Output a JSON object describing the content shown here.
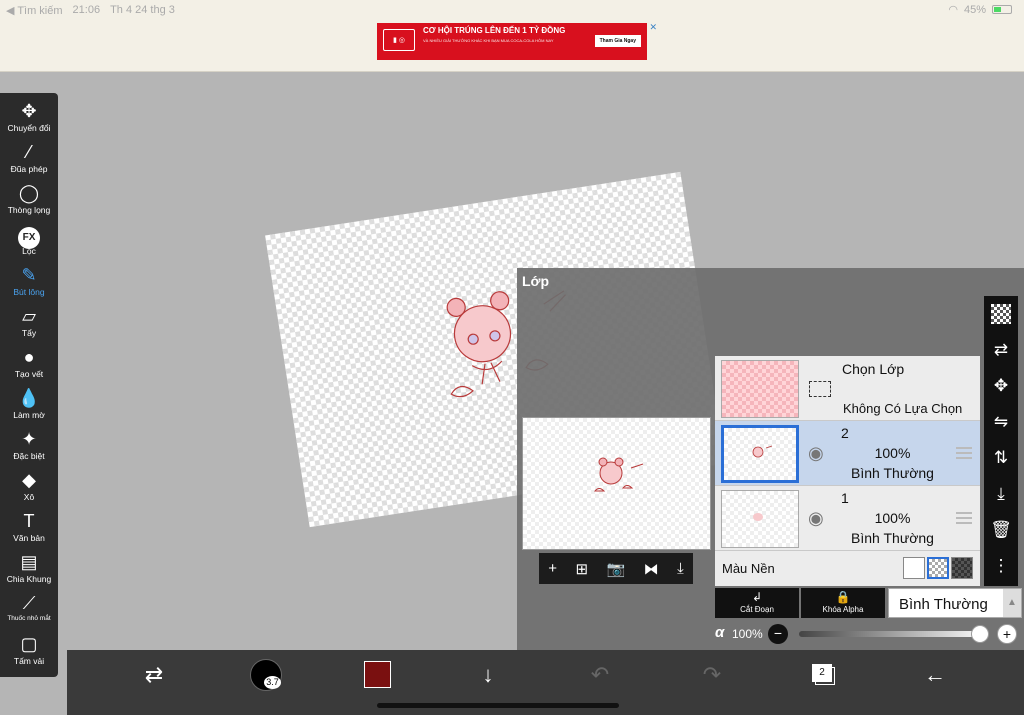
{
  "status_bar": {
    "back": "◀ Tìm kiếm",
    "time": "21:06",
    "date": "Th 4 24 thg 3",
    "battery": "45%"
  },
  "ad": {
    "headline": "CƠ HỘI TRÚNG LÊN ĐẾN 1 TỶ ĐỒNG",
    "subline": "VÀ NHIỀU GIẢI THƯỞNG KHÁC KHI BẠN MUA COCA-COLA HÔM NAY",
    "cta": "Tham Gia Ngay",
    "accent": "#d8101e"
  },
  "tools": [
    {
      "label": "Chuyển đổi",
      "icon": "✥"
    },
    {
      "label": "Đũa phép",
      "icon": "⁄"
    },
    {
      "label": "Thòng lọng",
      "icon": "◯"
    },
    {
      "label": "Lọc",
      "icon": "FX"
    },
    {
      "label": "Bút lông",
      "icon": "✎"
    },
    {
      "label": "Tẩy",
      "icon": "▱"
    },
    {
      "label": "Tạo vết",
      "icon": "●"
    },
    {
      "label": "Làm mờ",
      "icon": "💧"
    },
    {
      "label": "Đặc biệt",
      "icon": "✦"
    },
    {
      "label": "Xô",
      "icon": "◆"
    },
    {
      "label": "Văn bản",
      "icon": "T"
    },
    {
      "label": "Chia Khung",
      "icon": "▤"
    },
    {
      "label": "Thuốc nhỏ mắt",
      "icon": "⟋"
    },
    {
      "label": "Tấm vải",
      "icon": "▢"
    }
  ],
  "active_tool_color": "#4aa3f0",
  "layer_panel": {
    "title": "Lớp",
    "selection_layer": {
      "title": "Chọn Lớp",
      "status": "Không Có Lựa Chọn"
    },
    "layers": [
      {
        "number": "2",
        "opacity": "100%",
        "blend": "Bình Thường",
        "selected": true
      },
      {
        "number": "1",
        "opacity": "100%",
        "blend": "Bình Thường",
        "selected": false
      }
    ],
    "background": {
      "label": "Màu Nền"
    },
    "clip_label": "Cắt Đoạn",
    "alpha_lock_label": "Khóa Alpha",
    "blend_mode": "Bình Thường",
    "alpha_symbol": "α",
    "opacity_value": "100%",
    "opacity_fraction": 1.0,
    "preview_toolbar": [
      "+",
      "⊞",
      "📷",
      "⧓",
      "⤓"
    ]
  },
  "right_toolbar": [
    "checker",
    "⇄",
    "✥",
    "⇋",
    "⇅",
    "⤓",
    "🗑",
    "⋮"
  ],
  "bottom_bar": {
    "brush_size": "3.7",
    "current_color": "#7a1010",
    "layer_count": "2"
  }
}
